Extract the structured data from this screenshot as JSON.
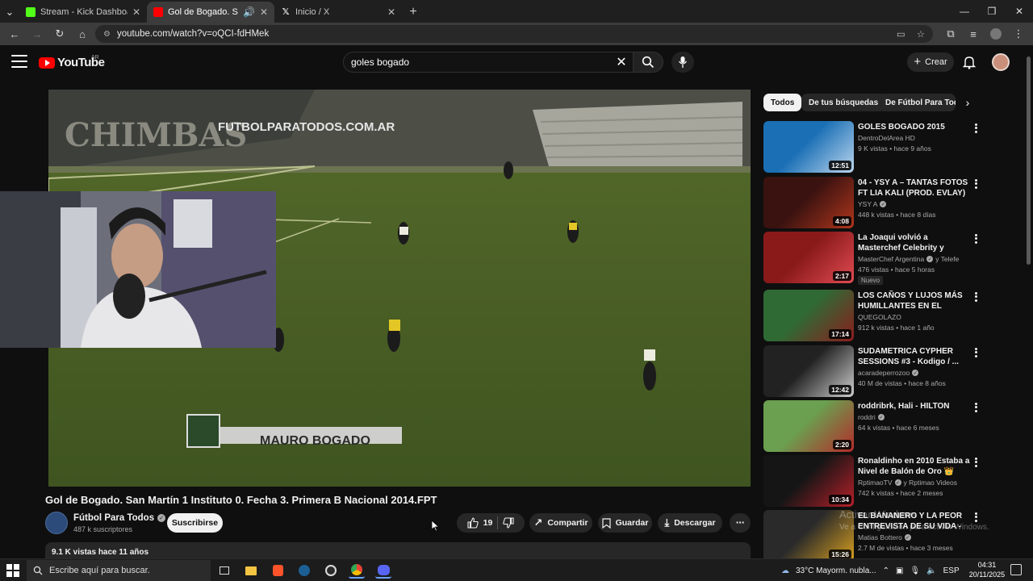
{
  "browser": {
    "tabs": [
      {
        "title": "Stream - Kick Dashboard",
        "favicon_color": "#53fc18",
        "active": false
      },
      {
        "title": "Gol de Bogado. San Martín",
        "favicon_color": "#ff0000",
        "active": true
      },
      {
        "title": "Inicio / X",
        "favicon_color": "#ffffff",
        "active": false
      }
    ],
    "url": "youtube.com/watch?v=oQCI-fdHMek"
  },
  "youtube": {
    "logo_text": "YouTube",
    "country": "AR",
    "search_query": "goles bogado",
    "create_label": "Crear"
  },
  "video": {
    "overlay_site": "FUTBOLPARATODOS.COM.AR",
    "overlay_player": "MAURO BOGADO",
    "banner_text": "CHIMBAS",
    "title": "Gol de Bogado. San Martín 1 Instituto 0. Fecha 3. Primera B Nacional 2014.FPT",
    "channel": "Fútbol Para Todos",
    "subscribers": "487 k suscriptores",
    "subscribe_label": "Suscribirse",
    "likes": "19",
    "share_label": "Compartir",
    "save_label": "Guardar",
    "download_label": "Descargar",
    "desc_meta": "9.1 K vistas  hace 11 años"
  },
  "chips": [
    "Todos",
    "De tus búsquedas",
    "De Fútbol Para Todos"
  ],
  "recommendations": [
    {
      "title": "GOLES BOGADO 2015",
      "channel": "DentroDelArea HD",
      "verified": false,
      "meta": "9 K vistas • hace 9 años",
      "duration": "12:51",
      "new": false,
      "colors": [
        "#1a6fb5",
        "#bcd6ee"
      ]
    },
    {
      "title": "04 - YSY A – TANTAS FOTOS FT LIA KALI (PROD. EVLAY)",
      "channel": "YSY A",
      "verified": true,
      "meta": "448 k vistas • hace 8 días",
      "duration": "4:08",
      "new": false,
      "colors": [
        "#3a1210",
        "#b0361c"
      ]
    },
    {
      "title": "La Joaqui volvió a Masterchef Celebrity y sorprendió: \"Vi ...",
      "channel": "MasterChef Argentina",
      "channel2": "y Telefe",
      "verified": true,
      "meta": "476 vistas • hace 5 horas",
      "duration": "2:17",
      "new": true,
      "new_label": "Nuevo",
      "colors": [
        "#8a1a1a",
        "#e14b52"
      ]
    },
    {
      "title": "LOS CAÑOS Y LUJOS MÁS HUMILLANTES EN EL FÚTBOL...",
      "channel": "QUEGOLAZO",
      "verified": false,
      "meta": "912 k vistas • hace 1 año",
      "duration": "17:14",
      "new": false,
      "colors": [
        "#2f6a35",
        "#8b1d1d"
      ]
    },
    {
      "title": "SUDAMETRICA CYPHER SESSIONS #3 - Kodigo / ...",
      "channel": "acaradeperrozoo",
      "verified": true,
      "meta": "40 M de vistas • hace 8 años",
      "duration": "12:42",
      "new": false,
      "colors": [
        "#222222",
        "#cfcfcf"
      ]
    },
    {
      "title": "roddribrk, Hali - HILTON",
      "channel": "roddri",
      "verified": true,
      "meta": "64 k vistas • hace 6 meses",
      "duration": "2:20",
      "new": false,
      "colors": [
        "#6aa050",
        "#b52a2a"
      ]
    },
    {
      "title": "Ronaldinho en 2010 Estaba a Nivel de Balón de Oro 👑",
      "channel": "RptimaoTV",
      "channel2": "y Rptimao Videos",
      "verified": true,
      "meta": "742 k vistas • hace 2 meses",
      "duration": "10:34",
      "new": false,
      "colors": [
        "#151515",
        "#b8202a"
      ]
    },
    {
      "title": "EL BANANERO Y LA PEOR ENTREVISTA DE SU VIDA -",
      "channel": "Matias Bottero",
      "verified": true,
      "meta": "2.7 M de vistas • hace 3 meses",
      "duration": "15:26",
      "new": false,
      "colors": [
        "#2a2a2a",
        "#d9a020"
      ]
    }
  ],
  "watermark": {
    "line1": "Activar Windows",
    "line2": "Ve a Configuración para activar Windows."
  },
  "taskbar": {
    "search_placeholder": "Escribe aquí para buscar.",
    "weather": "33°C  Mayorm. nubla...",
    "lang": "ESP",
    "time": "04:31",
    "date": "20/11/2025"
  }
}
